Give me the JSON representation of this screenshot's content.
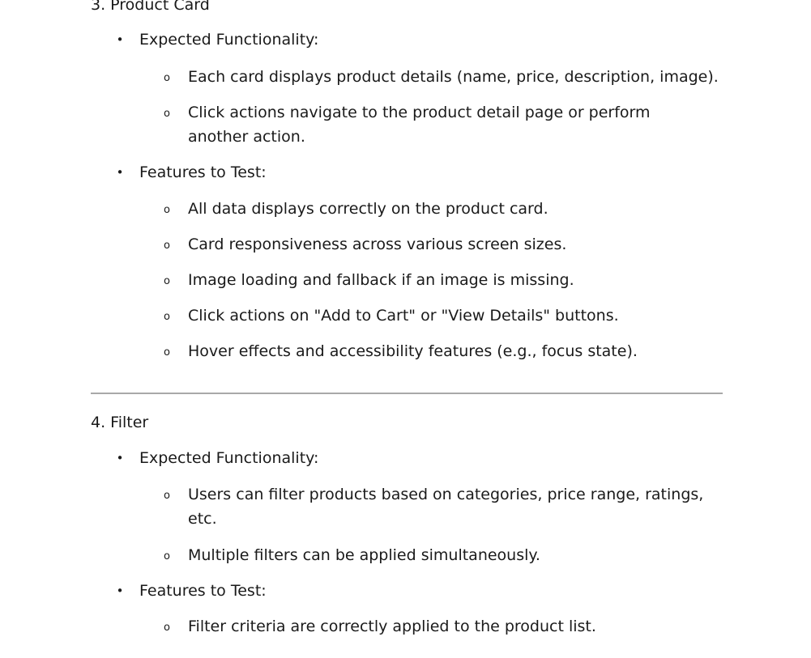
{
  "section3": {
    "title": "3. Product Card",
    "groups": [
      {
        "label": "Expected Functionality:",
        "items": [
          "Each card displays product details (name, price, description, image).",
          "Click actions navigate to the product detail page or perform another action."
        ]
      },
      {
        "label": "Features to Test:",
        "items": [
          "All data displays correctly on the product card.",
          "Card responsiveness across various screen sizes.",
          "Image loading and fallback if an image is missing.",
          "Click actions on \"Add to Cart\" or \"View Details\" buttons.",
          "Hover effects and accessibility features (e.g., focus state)."
        ]
      }
    ]
  },
  "section4": {
    "title": "4. Filter",
    "groups": [
      {
        "label": "Expected Functionality:",
        "items": [
          "Users can filter products based on categories, price range, ratings, etc.",
          "Multiple filters can be applied simultaneously."
        ]
      },
      {
        "label": "Features to Test:",
        "items": [
          "Filter criteria are correctly applied to the product list."
        ]
      }
    ]
  },
  "markers": {
    "bullet": "•",
    "sub_bullet": "o"
  }
}
